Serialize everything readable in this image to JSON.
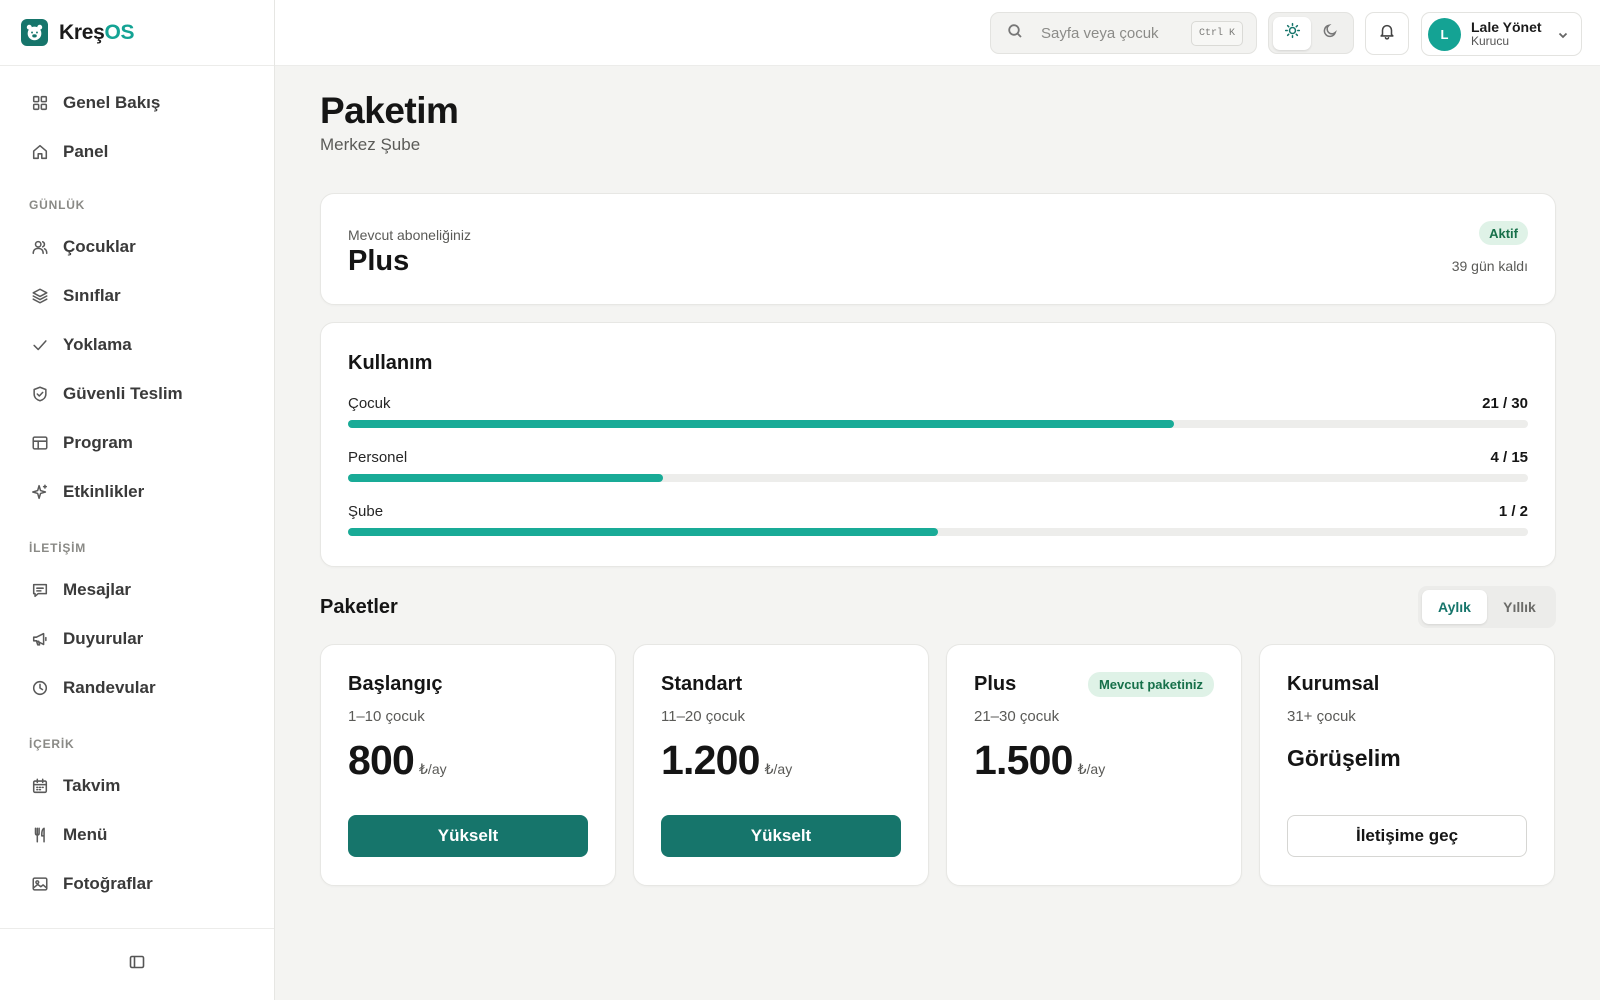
{
  "brand": {
    "name_main": "Kreş",
    "name_accent": "OS"
  },
  "sidebar": {
    "items": [
      {
        "label": "Genel Bakış",
        "icon": "grid-icon"
      },
      {
        "label": "Panel",
        "icon": "home-icon"
      }
    ],
    "sections": [
      {
        "title": "GÜNLÜK",
        "items": [
          {
            "label": "Çocuklar",
            "icon": "users-icon"
          },
          {
            "label": "Sınıflar",
            "icon": "layers-icon"
          },
          {
            "label": "Yoklama",
            "icon": "check-icon"
          },
          {
            "label": "Güvenli Teslim",
            "icon": "shield-check-icon"
          },
          {
            "label": "Program",
            "icon": "table-icon"
          },
          {
            "label": "Etkinlikler",
            "icon": "sparkles-icon"
          }
        ]
      },
      {
        "title": "İLETİŞİM",
        "items": [
          {
            "label": "Mesajlar",
            "icon": "message-icon"
          },
          {
            "label": "Duyurular",
            "icon": "megaphone-icon"
          },
          {
            "label": "Randevular",
            "icon": "clock-icon"
          }
        ]
      },
      {
        "title": "İÇERİK",
        "items": [
          {
            "label": "Takvim",
            "icon": "calendar-icon"
          },
          {
            "label": "Menü",
            "icon": "utensils-icon"
          },
          {
            "label": "Fotoğraflar",
            "icon": "image-icon"
          }
        ]
      }
    ]
  },
  "header": {
    "search_placeholder": "Sayfa veya çocuk",
    "search_shortcut": "Ctrl K",
    "user": {
      "initial": "L",
      "name": "Lale Yönet",
      "role": "Kurucu"
    }
  },
  "page": {
    "title": "Paketim",
    "subtitle": "Merkez Şube"
  },
  "subscription": {
    "label": "Mevcut aboneliğiniz",
    "plan": "Plus",
    "status": "Aktif",
    "days_left": "39 gün kaldı"
  },
  "usage": {
    "title": "Kullanım",
    "rows": [
      {
        "label": "Çocuk",
        "value": "21 / 30",
        "fraction": 0.7
      },
      {
        "label": "Personel",
        "value": "4 / 15",
        "fraction": 0.2667
      },
      {
        "label": "Şube",
        "value": "1 / 2",
        "fraction": 0.5
      }
    ]
  },
  "packages": {
    "title": "Paketler",
    "period_options": [
      "Aylık",
      "Yıllık"
    ],
    "period_selected": "Aylık",
    "plans": [
      {
        "name": "Başlangıç",
        "range": "1–10 çocuk",
        "price": "800",
        "unit": "₺/ay",
        "button": "Yükselt"
      },
      {
        "name": "Standart",
        "range": "11–20 çocuk",
        "price": "1.200",
        "unit": "₺/ay",
        "button": "Yükselt"
      },
      {
        "name": "Plus",
        "range": "21–30 çocuk",
        "price": "1.500",
        "unit": "₺/ay",
        "badge": "Mevcut paketiniz"
      },
      {
        "name": "Kurumsal",
        "range": "31+ çocuk",
        "contact_text": "Görüşelim",
        "button": "İletişime geç"
      }
    ]
  },
  "colors": {
    "accent": "#16756b",
    "accent_bright": "#19ab97",
    "badge_bg": "#dff2e7",
    "badge_text": "#17704a"
  }
}
